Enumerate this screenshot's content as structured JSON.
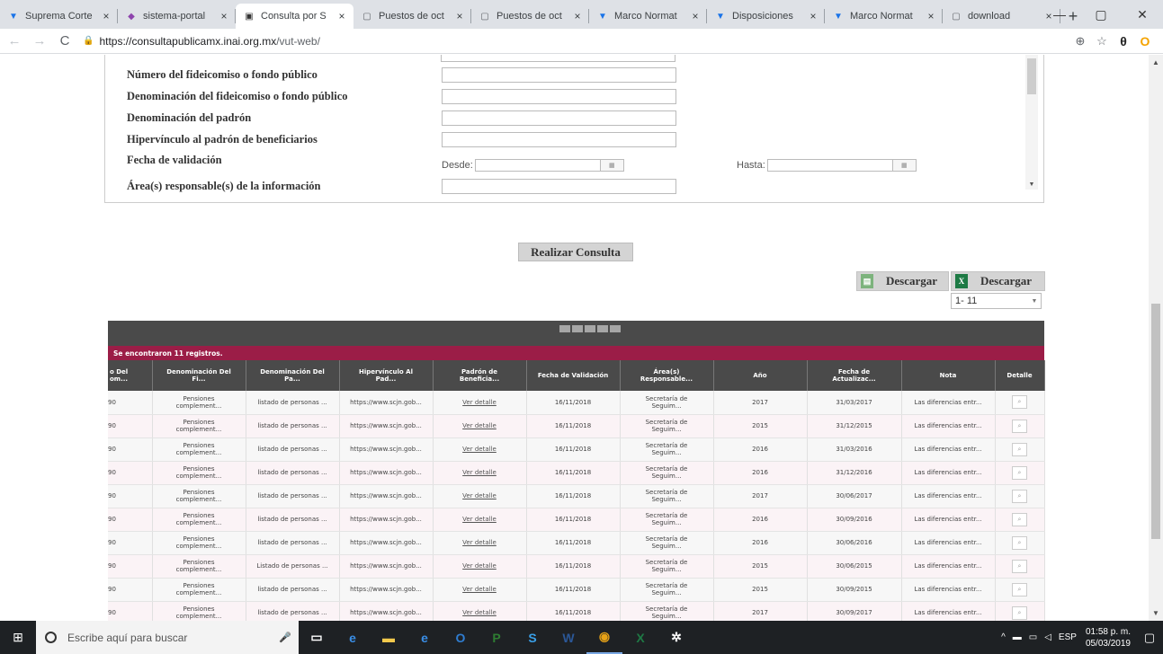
{
  "browser": {
    "tabs": [
      {
        "title": "Suprema Corte",
        "icon": "scjn-icon",
        "glyph": "▼",
        "color": "#1a73e8"
      },
      {
        "title": "sistema-portal",
        "icon": "portal-icon",
        "glyph": "◆",
        "color": "#8e44ad"
      },
      {
        "title": "Consulta por S",
        "icon": "inai-icon",
        "glyph": "▣",
        "color": "#333333",
        "active": true
      },
      {
        "title": "Puestos de oct",
        "icon": "page-icon",
        "glyph": "▢",
        "color": "#5f6368"
      },
      {
        "title": "Puestos de oct",
        "icon": "page-icon",
        "glyph": "▢",
        "color": "#5f6368"
      },
      {
        "title": "Marco Normat",
        "icon": "scjn-icon",
        "glyph": "▼",
        "color": "#1a73e8"
      },
      {
        "title": "Disposiciones",
        "icon": "scjn-icon",
        "glyph": "▼",
        "color": "#1a73e8"
      },
      {
        "title": "Marco Normat",
        "icon": "scjn-icon",
        "glyph": "▼",
        "color": "#1a73e8"
      },
      {
        "title": "download",
        "icon": "page-icon",
        "glyph": "▢",
        "color": "#5f6368"
      }
    ],
    "close_glyph": "×",
    "new_tab_glyph": "+",
    "window_controls": {
      "minimize": "—",
      "maximize": "▢",
      "close": "✕"
    },
    "nav": {
      "back": "←",
      "forward": "→",
      "reload": "C"
    },
    "url_host": "https://consultapublicamx.inai.org.mx",
    "url_path": "/vut-web/",
    "toolbar_icons": {
      "zoom": "⊕",
      "star": "☆",
      "profile": "θ",
      "extension": "O"
    }
  },
  "filters": {
    "fields": [
      {
        "label": "Número del fideicomiso o fondo público",
        "value": ""
      },
      {
        "label": "Denominación del fideicomiso o fondo público",
        "value": ""
      },
      {
        "label": "Denominación del padrón",
        "value": ""
      },
      {
        "label": "Hipervínculo al padrón de beneficiarios",
        "value": ""
      }
    ],
    "date_label": "Fecha de validación",
    "from_label": "Desde:",
    "to_label": "Hasta:",
    "from_value": "",
    "to_value": "",
    "area_label": "Área(s) responsable(s) de la información",
    "area_value": ""
  },
  "actions": {
    "consulta_label": "Realizar Consulta",
    "download_csv_label": "Descargar",
    "download_xls_label": "Descargar",
    "page_size_value": "1- 11"
  },
  "results": {
    "found_text": "Se encontraron 11 registros.",
    "columns": [
      {
        "l1": "o Del",
        "l2": "om..."
      },
      {
        "l1": "Denominación Del",
        "l2": "Fi..."
      },
      {
        "l1": "Denominación Del",
        "l2": "Pa..."
      },
      {
        "l1": "Hipervínculo Al",
        "l2": "Pad..."
      },
      {
        "l1": "Padrón de",
        "l2": "Beneficia..."
      },
      {
        "l1": "Fecha de Validación",
        "l2": ""
      },
      {
        "l1": "Área(s)",
        "l2": "Responsable..."
      },
      {
        "l1": "Año",
        "l2": ""
      },
      {
        "l1": "Fecha de",
        "l2": "Actualizac..."
      },
      {
        "l1": "Nota",
        "l2": ""
      },
      {
        "l1": "Detalle",
        "l2": ""
      }
    ],
    "rows": [
      {
        "num": "90",
        "fi1": "Pensiones",
        "fi2": "complement...",
        "pa": "listado de personas ...",
        "hip": "https://www.scjn.gob...",
        "padron": "Ver detalle",
        "fecha_val": "16/11/2018",
        "area1": "Secretaría de",
        "area2": "Seguim...",
        "anio": "2017",
        "fecha_act": "31/03/2017",
        "nota": "Las diferencias entr..."
      },
      {
        "num": "90",
        "fi1": "Pensiones",
        "fi2": "complement...",
        "pa": "listado de personas ...",
        "hip": "https://www.scjn.gob...",
        "padron": "Ver detalle",
        "fecha_val": "16/11/2018",
        "area1": "Secretaría de",
        "area2": "Seguim...",
        "anio": "2015",
        "fecha_act": "31/12/2015",
        "nota": "Las diferencias entr..."
      },
      {
        "num": "90",
        "fi1": "Pensiones",
        "fi2": "complement...",
        "pa": "listado de personas ...",
        "hip": "https://www.scjn.gob...",
        "padron": "Ver detalle",
        "fecha_val": "16/11/2018",
        "area1": "Secretaría de",
        "area2": "Seguim...",
        "anio": "2016",
        "fecha_act": "31/03/2016",
        "nota": "Las diferencias entr..."
      },
      {
        "num": "90",
        "fi1": "Pensiones",
        "fi2": "complement...",
        "pa": "listado de personas ...",
        "hip": "https://www.scjn.gob...",
        "padron": "Ver detalle",
        "fecha_val": "16/11/2018",
        "area1": "Secretaría de",
        "area2": "Seguim...",
        "anio": "2016",
        "fecha_act": "31/12/2016",
        "nota": "Las diferencias entr..."
      },
      {
        "num": "90",
        "fi1": "Pensiones",
        "fi2": "complement...",
        "pa": "listado de personas ...",
        "hip": "https://www.scjn.gob...",
        "padron": "Ver detalle",
        "fecha_val": "16/11/2018",
        "area1": "Secretaría de",
        "area2": "Seguim...",
        "anio": "2017",
        "fecha_act": "30/06/2017",
        "nota": "Las diferencias entr..."
      },
      {
        "num": "90",
        "fi1": "Pensiones",
        "fi2": "complement...",
        "pa": "listado de personas ...",
        "hip": "https://www.scjn.gob...",
        "padron": "Ver detalle",
        "fecha_val": "16/11/2018",
        "area1": "Secretaría de",
        "area2": "Seguim...",
        "anio": "2016",
        "fecha_act": "30/09/2016",
        "nota": "Las diferencias entr..."
      },
      {
        "num": "90",
        "fi1": "Pensiones",
        "fi2": "complement...",
        "pa": "listado de personas ...",
        "hip": "https://www.scjn.gob...",
        "padron": "Ver detalle",
        "fecha_val": "16/11/2018",
        "area1": "Secretaría de",
        "area2": "Seguim...",
        "anio": "2016",
        "fecha_act": "30/06/2016",
        "nota": "Las diferencias entr..."
      },
      {
        "num": "90",
        "fi1": "Pensiones",
        "fi2": "complement...",
        "pa": "Listado de personas ...",
        "hip": "https://www.scjn.gob...",
        "padron": "Ver detalle",
        "fecha_val": "16/11/2018",
        "area1": "Secretaría de",
        "area2": "Seguim...",
        "anio": "2015",
        "fecha_act": "30/06/2015",
        "nota": "Las diferencias entr..."
      },
      {
        "num": "90",
        "fi1": "Pensiones",
        "fi2": "complement...",
        "pa": "listado de personas ...",
        "hip": "https://www.scjn.gob...",
        "padron": "Ver detalle",
        "fecha_val": "16/11/2018",
        "area1": "Secretaría de",
        "area2": "Seguim...",
        "anio": "2015",
        "fecha_act": "30/09/2015",
        "nota": "Las diferencias entr..."
      },
      {
        "num": "90",
        "fi1": "Pensiones",
        "fi2": "complement...",
        "pa": "listado de personas ...",
        "hip": "https://www.scjn.gob...",
        "padron": "Ver detalle",
        "fecha_val": "16/11/2018",
        "area1": "Secretaría de",
        "area2": "Seguim...",
        "anio": "2017",
        "fecha_act": "30/09/2017",
        "nota": "Las diferencias entr..."
      }
    ],
    "detail_glyph": "⌕"
  },
  "taskbar": {
    "search_placeholder": "Escribe aquí para buscar",
    "apps": [
      {
        "name": "task-view-icon",
        "glyph": "▭",
        "color": "#ffffff"
      },
      {
        "name": "edge-icon",
        "glyph": "e",
        "color": "#3a8ee6"
      },
      {
        "name": "file-explorer-icon",
        "glyph": "▬",
        "color": "#f2c94c"
      },
      {
        "name": "internet-explorer-icon",
        "glyph": "e",
        "color": "#3a8ee6"
      },
      {
        "name": "outlook-icon",
        "glyph": "O",
        "color": "#2f7dd1"
      },
      {
        "name": "project-icon",
        "glyph": "P",
        "color": "#2e7d32"
      },
      {
        "name": "skype-icon",
        "glyph": "S",
        "color": "#3aa0e8"
      },
      {
        "name": "word-icon",
        "glyph": "W",
        "color": "#2b5797"
      },
      {
        "name": "chrome-icon",
        "glyph": "◉",
        "color": "#e8a317",
        "active": true
      },
      {
        "name": "excel-icon",
        "glyph": "X",
        "color": "#1e7a45"
      },
      {
        "name": "settings-icon",
        "glyph": "✲",
        "color": "#ffffff"
      }
    ],
    "language": "ESP",
    "time": "01:58 p. m.",
    "date": "05/03/2019"
  }
}
